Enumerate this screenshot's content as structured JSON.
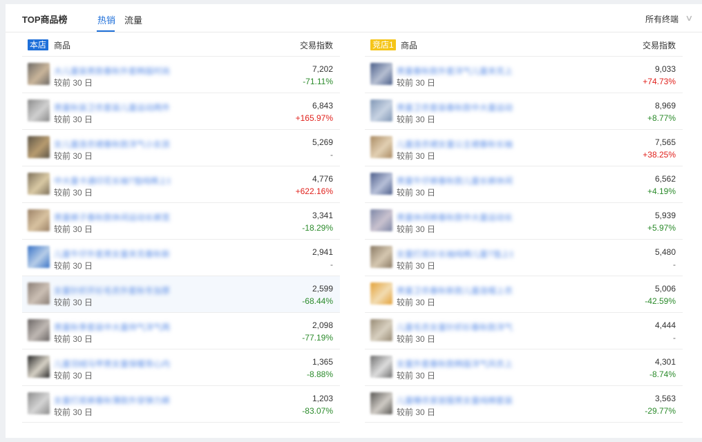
{
  "header": {
    "title": "TOP商品榜",
    "tabs": [
      "热销",
      "流量"
    ],
    "dropdown": "所有终端"
  },
  "colors": {
    "accent": "#1e6fd9",
    "own_badge": "#1e6fd9",
    "comp_badge": "#f5c518",
    "up": "#e0201b",
    "down": "#2a8a2a"
  },
  "left_panel": {
    "badge": "本店",
    "col_product": "商品",
    "col_index": "交易指数",
    "rows": [
      {
        "name": "大儿童装男款春秋外套韩版时尚潮流",
        "compare": "较前 30 日",
        "value": "7,202",
        "change": "-71.11%",
        "dir": "down",
        "thumb": [
          "#6e6a66",
          "#c9b59a"
        ]
      },
      {
        "name": "男童秋装卫衣套装儿童运动两件套",
        "compare": "较前 30 日",
        "value": "6,843",
        "change": "+165.97%",
        "dir": "up",
        "thumb": [
          "#8a8a8a",
          "#d0d0d0"
        ]
      },
      {
        "name": "女儿童连衣裙春秋款洋气小女孩裙子",
        "compare": "较前 30 日",
        "value": "5,269",
        "change": "-",
        "dir": "neutral",
        "thumb": [
          "#5d5547",
          "#b79b6f"
        ]
      },
      {
        "name": "中大童卡通印花长袖T恤纯棉上衣",
        "compare": "较前 30 日",
        "value": "4,776",
        "change": "+622.16%",
        "dir": "up",
        "thumb": [
          "#7d705a",
          "#d9c9a4"
        ]
      },
      {
        "name": "男童裤子春秋款休闲运动长裤宽松",
        "compare": "较前 30 日",
        "value": "3,341",
        "change": "-18.29%",
        "dir": "down",
        "thumb": [
          "#9c8267",
          "#d8c2a0"
        ]
      },
      {
        "name": "儿童牛仔外套男女童夹克春秋新款",
        "compare": "较前 30 日",
        "value": "2,941",
        "change": "-",
        "dir": "neutral",
        "thumb": [
          "#3a74c7",
          "#b7cde8"
        ]
      },
      {
        "name": "女童针织开衫毛衣外套秋冬加厚款",
        "compare": "较前 30 日",
        "value": "2,599",
        "change": "-68.44%",
        "dir": "down",
        "thumb": [
          "#8a7e76",
          "#cbbfb4"
        ]
      },
      {
        "name": "男童秋季套装中大童帅气洋气两件",
        "compare": "较前 30 日",
        "value": "2,098",
        "change": "-77.19%",
        "dir": "down",
        "thumb": [
          "#6a6564",
          "#bfb8b3"
        ]
      },
      {
        "name": "儿童羽绒马甲男女童保暖背心内搭",
        "compare": "较前 30 日",
        "value": "1,365",
        "change": "-8.88%",
        "dir": "down",
        "thumb": [
          "#2a2a2a",
          "#d7d2c6"
        ]
      },
      {
        "name": "女童打底裤春秋薄款外穿弹力裤子",
        "compare": "较前 30 日",
        "value": "1,203",
        "change": "-83.07%",
        "dir": "down",
        "thumb": [
          "#8d8d8d",
          "#d4d4d4"
        ]
      }
    ]
  },
  "right_panel": {
    "badge": "竞店1",
    "col_product": "商品",
    "col_index": "交易指数",
    "rows": [
      {
        "name": "男童春秋款外套洋气儿童夹克上衣",
        "compare": "较前 30 日",
        "value": "9,033",
        "change": "+74.73%",
        "dir": "up",
        "thumb": [
          "#4b5f8a",
          "#b6bfd2"
        ]
      },
      {
        "name": "男童卫衣套装春秋款中大童运动服",
        "compare": "较前 30 日",
        "value": "8,969",
        "change": "+8.77%",
        "dir": "down",
        "thumb": [
          "#7f96b5",
          "#c8d3e3"
        ]
      },
      {
        "name": "儿童连衣裙女童公主裙春秋长袖款",
        "compare": "较前 30 日",
        "value": "7,565",
        "change": "+38.25%",
        "dir": "up",
        "thumb": [
          "#a98a62",
          "#e2d0b3"
        ]
      },
      {
        "name": "男童牛仔裤春秋款儿童长裤休闲裤",
        "compare": "较前 30 日",
        "value": "6,562",
        "change": "+4.19%",
        "dir": "down",
        "thumb": [
          "#4e5f8c",
          "#b7c0d8"
        ]
      },
      {
        "name": "男童休闲裤春秋款中大童运动长裤",
        "compare": "较前 30 日",
        "value": "5,939",
        "change": "+5.97%",
        "dir": "down",
        "thumb": [
          "#7c86a6",
          "#c9c2cf"
        ]
      },
      {
        "name": "女童打底衫长袖纯棉儿童T恤上衣",
        "compare": "较前 30 日",
        "value": "5,480",
        "change": "-",
        "dir": "neutral",
        "thumb": [
          "#8a7a64",
          "#d5c7b0"
        ]
      },
      {
        "name": "男童卫衣春秋新款儿童连帽上衣潮",
        "compare": "较前 30 日",
        "value": "5,006",
        "change": "-42.59%",
        "dir": "down",
        "thumb": [
          "#e3a23a",
          "#f2dcb2"
        ]
      },
      {
        "name": "儿童毛衣女童针织衫春秋款洋气",
        "compare": "较前 30 日",
        "value": "4,444",
        "change": "-",
        "dir": "neutral",
        "thumb": [
          "#978a74",
          "#d8d0c0"
        ]
      },
      {
        "name": "女童外套春秋款韩版洋气风衣上衣",
        "compare": "较前 30 日",
        "value": "4,301",
        "change": "-8.74%",
        "dir": "down",
        "thumb": [
          "#6f6f6f",
          "#dddddd"
        ]
      },
      {
        "name": "儿童睡衣家居服男女童纯棉套装",
        "compare": "较前 30 日",
        "value": "3,563",
        "change": "-29.77%",
        "dir": "down",
        "thumb": [
          "#5a5855",
          "#cfcbc5"
        ]
      }
    ]
  }
}
